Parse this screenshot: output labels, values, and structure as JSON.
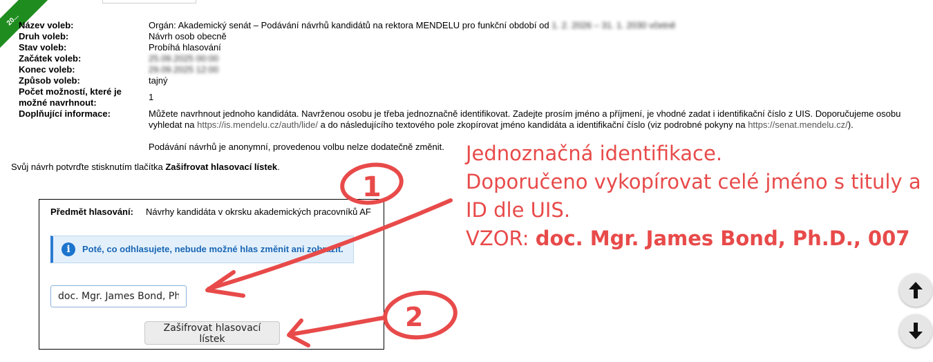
{
  "ribbon": {
    "text": "20..."
  },
  "election": {
    "rows": [
      {
        "label": "Název voleb:",
        "value": "Orgán: Akademický senát – Podávání návrhů kandidátů na rektora MENDELU pro funkční období od",
        "blurred": "1. 2. 2026 – 31. 1. 2030 včetně"
      },
      {
        "label": "Druh voleb:",
        "value": "Návrh osob obecně"
      },
      {
        "label": "Stav voleb:",
        "value": "Probíhá hlasování"
      },
      {
        "label": "Začátek voleb:",
        "value": "",
        "blurred": "25.09.2025 00:00"
      },
      {
        "label": "Konec voleb:",
        "value": "",
        "blurred": "29.09.2025 12:00"
      },
      {
        "label": "Způsob voleb:",
        "value": "tajný"
      },
      {
        "label": "Počet možností, které je možné navrhnout:",
        "value": "1"
      },
      {
        "label": "Doplňující informace:",
        "value": ""
      }
    ],
    "info": {
      "p1_a": "Můžete navrhnout jednoho kandidáta. Navrženou osobu je třeba jednoznačně identifikovat. Zadejte prosím jméno a příjmení, je vhodné zadat i identifikační číslo z UIS. Doporučujeme osobu vyhledat na ",
      "link1": "https://is.mendelu.cz/auth/lide/",
      "p1_b": " a do následujícího textového pole zkopírovat jméno kandidáta a identifikační číslo (viz podrobné pokyny na ",
      "link2": "https://senat.mendelu.cz/",
      "p1_c": ").",
      "p2": "Podávání návrhů je anonymní, provedenou volbu nelze dodatečně změnit."
    }
  },
  "confirm": {
    "prefix": "Svůj návrh potvrďte stisknutím tlačítka ",
    "button_ref": "Zašifrovat hlasovací lístek",
    "suffix": "."
  },
  "ballot": {
    "subject_label": "Předmět hlasování:",
    "subject_value": "Návrhy kandidáta v okrsku akademických pracovníků AF",
    "notice": "Poté, co odhlasujete, nebude možné hlas změnit ani zobrazit.",
    "input_value": "doc. Mgr. James Bond, PhD",
    "submit_label": "Zašifrovat hlasovací lístek"
  },
  "annotation": {
    "line1": "Jednoznačná identifikace.",
    "line2": "Doporučeno vykopírovat celé jméno s tituly a ID dle UIS.",
    "vzor_label": "VZOR: ",
    "vzor_value": "doc. Mgr. James Bond, Ph.D., 007",
    "marker1": "1",
    "marker2": "2"
  },
  "colors": {
    "annotation": "#e84a4a",
    "ribbon": "#1f8c1f",
    "notice_text": "#1966b5",
    "notice_icon": "#1c74cd"
  },
  "icons": {
    "notice": "info-icon",
    "scroll_up": "arrow-up-icon",
    "scroll_down": "arrow-down-icon"
  }
}
